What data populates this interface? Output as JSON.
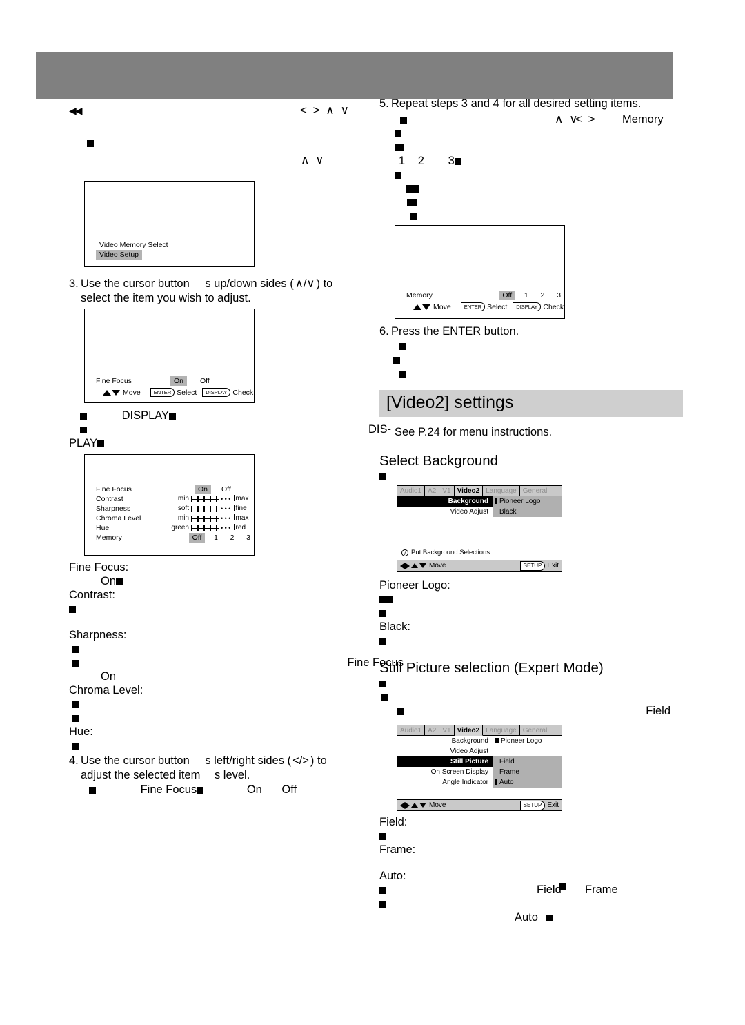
{
  "page": {
    "header_band_color": "#808080",
    "accent_heading_bg": "#cfcfcf",
    "osd_highlight": "#b3b3b3",
    "menu_option_bg": "#b0b0b0"
  },
  "left_column": {
    "rew_icon": "◀◀",
    "cursor_arrows_top": "< > ∧ ∨",
    "cursor_arrows_mid": "∧ ∨",
    "tv_memory_select": {
      "line1": "Video Memory Select",
      "line2": "Video Setup"
    },
    "step3": {
      "number": "3.",
      "text_a": "Use the cursor button",
      "text_b": "s up/down sides (",
      "arrows": "∧/∨",
      "text_c": ") to",
      "line2": "select the item you wish to adjust."
    },
    "tv_fine_focus": {
      "label": "Fine Focus",
      "value_on": "On",
      "value_off": "Off",
      "guide_move": "Move",
      "key_enter": "ENTER",
      "guide_select": "Select",
      "key_display": "DISPLAY",
      "guide_check": "Check"
    },
    "display_note": {
      "word_display": "DISPLAY",
      "word_dis": "DIS-",
      "word_play": "PLAY"
    },
    "tv_video_setup": {
      "rows": [
        {
          "label": "Fine Focus",
          "type": "toggle",
          "on": "On",
          "off": "Off"
        },
        {
          "label": "Contrast",
          "type": "slider",
          "min": "min",
          "max": "max"
        },
        {
          "label": "Sharpness",
          "type": "slider",
          "min": "soft",
          "max": "fine"
        },
        {
          "label": "Chroma Level",
          "type": "slider",
          "min": "min",
          "max": "max"
        },
        {
          "label": "Hue",
          "type": "slider",
          "min": "green",
          "max": "red"
        },
        {
          "label": "Memory",
          "type": "memory",
          "off": "Off",
          "slots": [
            "1",
            "2",
            "3"
          ]
        }
      ]
    },
    "definitions": [
      "Fine Focus:",
      "On",
      "Contrast:",
      "Sharpness:",
      "Fine Focus",
      "On",
      "Chroma Level:",
      "Hue:"
    ],
    "def_fine_focus": "Fine Focus:",
    "def_on": "On",
    "def_contrast": "Contrast:",
    "def_sharpness": "Sharpness:",
    "def_fine_focus_ref": "Fine Focus",
    "def_on2": "On",
    "def_chroma": "Chroma Level:",
    "def_hue": "Hue:",
    "step4": {
      "number": "4.",
      "text_a": "Use the cursor button",
      "text_b": "s left/right sides (",
      "arrows": "</>",
      "text_c": ") to",
      "line2": "adjust the selected item",
      "line2b": "s level.",
      "note_fine_focus": "Fine Focus",
      "note_on": "On",
      "note_off": "Off"
    }
  },
  "right_column": {
    "step5": {
      "number": "5.",
      "text": "Repeat steps 3 and 4 for all desired setting items."
    },
    "step5_notes": {
      "arrows_updown": "∧ ∨",
      "word_memory": "Memory",
      "arrows_leftright": "< >",
      "slots": [
        "1",
        "2",
        "3"
      ]
    },
    "tv_memory": {
      "label": "Memory",
      "value_off": "Off",
      "slots": [
        "1",
        "2",
        "3"
      ],
      "guide_move": "Move",
      "key_enter": "ENTER",
      "guide_select": "Select",
      "key_display": "DISPLAY",
      "guide_check": "Check"
    },
    "step6": {
      "number": "6.",
      "text": "Press the ENTER button."
    },
    "section_heading": "[Video2] settings",
    "see_page": "See P.24 for menu instructions.",
    "select_background": {
      "heading": "Select Background",
      "menu": {
        "tabs": [
          {
            "label": "Audio1",
            "active": false
          },
          {
            "label": "A2",
            "active": false
          },
          {
            "label": "V1",
            "active": false
          },
          {
            "label": "Video2",
            "active": true
          },
          {
            "label": "Language",
            "active": false
          },
          {
            "label": "General",
            "active": false
          }
        ],
        "rows": [
          {
            "label": "Background",
            "selected": true
          },
          {
            "label": "Video Adjust",
            "selected": false
          }
        ],
        "options": [
          {
            "label": "Pioneer Logo",
            "marked": true
          },
          {
            "label": "Black",
            "marked": false
          }
        ],
        "info": "Put Background Selections",
        "foot_move": "Move",
        "foot_setup": "SETUP",
        "foot_exit": "Exit"
      },
      "def_pioneer_logo": "Pioneer Logo:",
      "def_black": "Black:"
    },
    "still_picture": {
      "heading": "Still Picture selection (Expert Mode)",
      "note_field": "Field",
      "menu": {
        "tabs": [
          {
            "label": "Audio1",
            "active": false
          },
          {
            "label": "A2",
            "active": false
          },
          {
            "label": "V1",
            "active": false
          },
          {
            "label": "Video2",
            "active": true
          },
          {
            "label": "Language",
            "active": false
          },
          {
            "label": "General",
            "active": false
          }
        ],
        "rows": [
          {
            "label": "Background",
            "selected": false
          },
          {
            "label": "Video Adjust",
            "selected": false
          },
          {
            "label": "Still Picture",
            "selected": true
          },
          {
            "label": "On Screen Display",
            "selected": false
          },
          {
            "label": "Angle Indicator",
            "selected": false
          }
        ],
        "top_option": {
          "label": "Pioneer Logo",
          "marked": true
        },
        "options": [
          {
            "label": "Field",
            "marked": false
          },
          {
            "label": "Frame",
            "marked": false
          },
          {
            "label": "Auto",
            "marked": true
          }
        ],
        "foot_move": "Move",
        "foot_setup": "SETUP",
        "foot_exit": "Exit"
      },
      "def_field": "Field:",
      "def_frame": "Frame:",
      "def_auto": "Auto:",
      "note_field2": "Field",
      "note_frame": "Frame",
      "note_auto": "Auto"
    }
  }
}
